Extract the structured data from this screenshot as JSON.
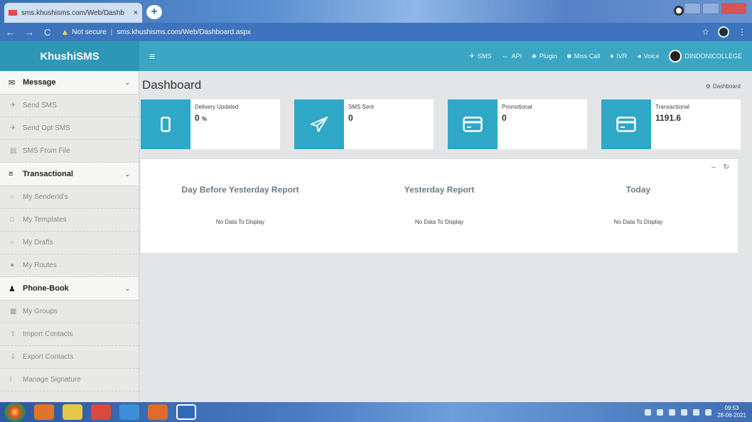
{
  "browser": {
    "tab_title": "sms.khushisms.com/Web/Dashb",
    "tab_close": "×",
    "new_tab": "+",
    "url_warning": "Not secure",
    "url_separator": "|",
    "url": "sms.khushisms.com/Web/Dashboard.aspx",
    "back": "←",
    "forward": "→",
    "reload": "C",
    "star": "☆"
  },
  "app": {
    "brand": "KhushiSMS",
    "hamburger": "≡",
    "topnav": [
      {
        "icon": "✈",
        "label": "SMS"
      },
      {
        "icon": "⇔",
        "label": "API"
      },
      {
        "icon": "♣",
        "label": "Plugin"
      },
      {
        "icon": "■",
        "label": "Miss Call"
      },
      {
        "icon": "♦",
        "label": "IVR"
      },
      {
        "icon": "◂",
        "label": "Voice"
      }
    ],
    "user": "DINDONICOLLEGE"
  },
  "sidebar": {
    "groups": [
      {
        "label": "Message",
        "icon": "✉",
        "items": [
          {
            "label": "Send SMS",
            "icon": "✈"
          },
          {
            "label": "Send Opt SMS",
            "icon": "✈"
          },
          {
            "label": "SMS From File",
            "icon": "▤"
          }
        ]
      },
      {
        "label": "Transactional",
        "icon": "≡",
        "items": [
          {
            "label": "My SenderId's",
            "icon": "○"
          },
          {
            "label": "My Templates",
            "icon": "□"
          },
          {
            "label": "My Drafts",
            "icon": "○"
          },
          {
            "label": "My Routes",
            "icon": "●"
          }
        ]
      },
      {
        "label": "Phone-Book",
        "icon": "♟",
        "items": [
          {
            "label": "My Groups",
            "icon": "▦"
          },
          {
            "label": "Import Contacts",
            "icon": "⇪"
          },
          {
            "label": "Export Contacts",
            "icon": "⇩"
          },
          {
            "label": "Manage Signature",
            "icon": "i"
          }
        ]
      }
    ],
    "chevron": "⌄"
  },
  "main": {
    "title": "Dashboard",
    "breadcrumb": "Dashboard",
    "stats": [
      {
        "label": "Delivery Updated",
        "value": "0",
        "unit": "%",
        "icon": "mobile-icon"
      },
      {
        "label": "SMS Sent",
        "value": "0",
        "unit": "",
        "icon": "send-icon"
      },
      {
        "label": "Promotional",
        "value": "0",
        "unit": "",
        "icon": "card-icon"
      },
      {
        "label": "Transactional",
        "value": "1191.6",
        "unit": "",
        "icon": "card-icon"
      }
    ],
    "panel_tools": "– ↻",
    "reports": [
      {
        "title": "Day Before Yesterday Report",
        "empty": "No Data To Display"
      },
      {
        "title": "Yesterday Report",
        "empty": "No Data To Display"
      },
      {
        "title": "Today",
        "empty": "No Data To Display"
      }
    ]
  },
  "taskbar": {
    "clock_time": "09:53",
    "clock_date": "28-08-2021"
  },
  "colors": {
    "accent": "#3aa6c4",
    "brand_bg": "#2d97b6",
    "stat_icon_bg": "#2fa7c7"
  }
}
